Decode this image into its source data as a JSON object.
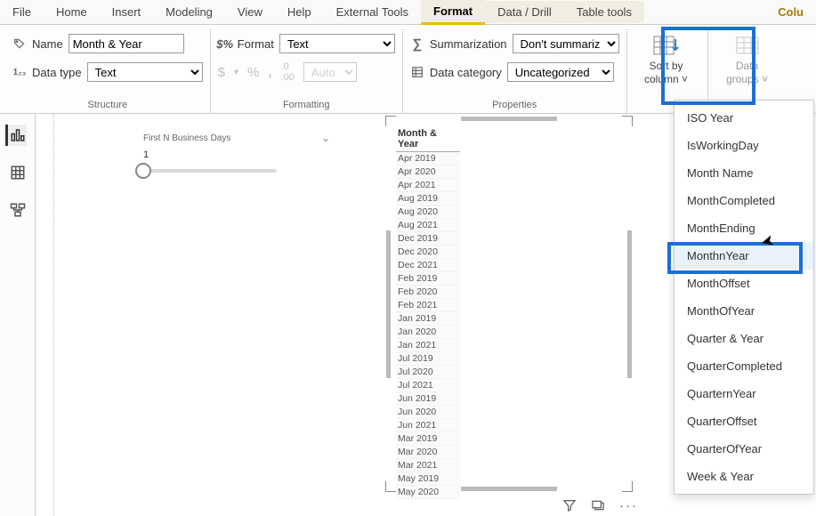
{
  "tabs": {
    "file": "File",
    "home": "Home",
    "insert": "Insert",
    "modeling": "Modeling",
    "view": "View",
    "help": "Help",
    "external": "External Tools",
    "format": "Format",
    "datadrill": "Data / Drill",
    "tabletools": "Table tools",
    "column": "Colu"
  },
  "structure": {
    "name_label": "Name",
    "name_value": "Month & Year",
    "datatype_label": "Data type",
    "datatype_value": "Text",
    "group": "Structure"
  },
  "formatting": {
    "format_label": "Format",
    "format_value": "Text",
    "auto": "Auto",
    "group": "Formatting",
    "dollar": "$",
    "percent": "%",
    "comma": ",",
    "decimals": ".00"
  },
  "properties": {
    "sum_label": "Summarization",
    "sum_value": "Don't summarize",
    "cat_label": "Data category",
    "cat_value": "Uncategorized",
    "group": "Properties"
  },
  "sort": {
    "label1": "Sort by",
    "label2": "column",
    "caret": "˅"
  },
  "datagroups": {
    "label1": "Data",
    "label2": "groups",
    "caret": "˅"
  },
  "slicer": {
    "title": "First N Business Days",
    "value": "1"
  },
  "table": {
    "header": "Month & Year",
    "rows": [
      "Apr 2019",
      "Apr 2020",
      "Apr 2021",
      "Aug 2019",
      "Aug 2020",
      "Aug 2021",
      "Dec 2019",
      "Dec 2020",
      "Dec 2021",
      "Feb 2019",
      "Feb 2020",
      "Feb 2021",
      "Jan 2019",
      "Jan 2020",
      "Jan 2021",
      "Jul 2019",
      "Jul 2020",
      "Jul 2021",
      "Jun 2019",
      "Jun 2020",
      "Jun 2021",
      "Mar 2019",
      "Mar 2020",
      "Mar 2021",
      "May 2019",
      "May 2020"
    ]
  },
  "menu": {
    "items": [
      "ISO Year",
      "IsWorkingDay",
      "Month Name",
      "MonthCompleted",
      "MonthEnding",
      "MonthnYear",
      "MonthOffset",
      "MonthOfYear",
      "Quarter & Year",
      "QuarterCompleted",
      "QuarternYear",
      "QuarterOffset",
      "QuarterOfYear",
      "Week & Year"
    ]
  },
  "chart_data": {
    "type": "table",
    "title": "Month & Year",
    "categories": [
      "Month & Year"
    ],
    "values": [
      "Apr 2019",
      "Apr 2020",
      "Apr 2021",
      "Aug 2019",
      "Aug 2020",
      "Aug 2021",
      "Dec 2019",
      "Dec 2020",
      "Dec 2021",
      "Feb 2019",
      "Feb 2020",
      "Feb 2021",
      "Jan 2019",
      "Jan 2020",
      "Jan 2021",
      "Jul 2019",
      "Jul 2020",
      "Jul 2021",
      "Jun 2019",
      "Jun 2020",
      "Jun 2021",
      "Mar 2019",
      "Mar 2020",
      "Mar 2021",
      "May 2019",
      "May 2020"
    ]
  }
}
